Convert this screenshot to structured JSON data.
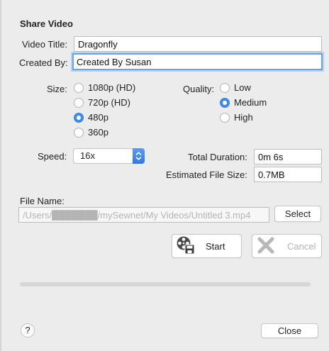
{
  "dialog": {
    "title": "Share Video"
  },
  "video_title": {
    "label": "Video Title:",
    "value": "Dragonfly"
  },
  "created_by": {
    "label": "Created By:",
    "value": "Created By Susan"
  },
  "size": {
    "label": "Size:",
    "options": [
      "1080p (HD)",
      "720p (HD)",
      "480p",
      "360p"
    ],
    "selected": "480p"
  },
  "quality": {
    "label": "Quality:",
    "options": [
      "Low",
      "Medium",
      "High"
    ],
    "selected": "Medium"
  },
  "speed": {
    "label": "Speed:",
    "value": "16x"
  },
  "total_duration": {
    "label": "Total Duration:",
    "value": "0m 6s"
  },
  "estimated_size": {
    "label": "Estimated File Size:",
    "value": "0.7MB"
  },
  "file_name": {
    "label": "File Name:",
    "value": "/Users/███████/mySewnet/My Videos/Untitled 3.mp4",
    "select_label": "Select"
  },
  "actions": {
    "start_label": "Start",
    "cancel_label": "Cancel",
    "close_label": "Close",
    "help_label": "?"
  },
  "progress": {
    "fraction": 0
  },
  "icons": {
    "start": "film-reel-save-icon",
    "cancel": "x-cancel-icon",
    "speed_stepper": "up-down-stepper-icon"
  },
  "colors": {
    "accent": "#3f8cf0",
    "focus_ring": "#6ea1e8"
  }
}
